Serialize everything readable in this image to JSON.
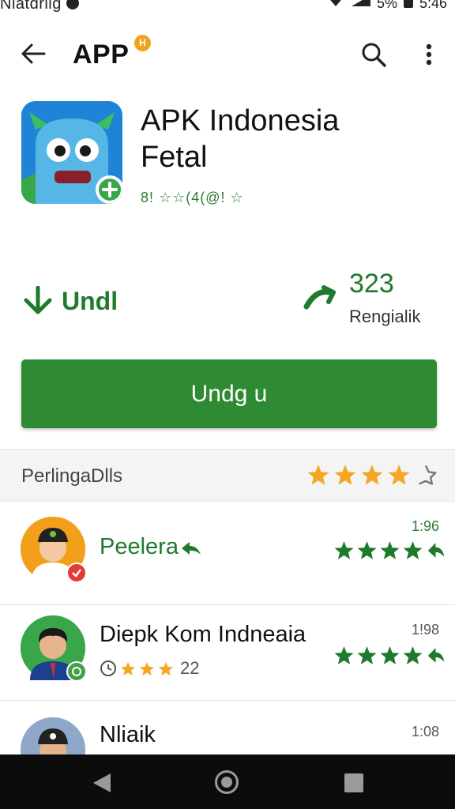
{
  "status_bar": {
    "left_text": "Nlatdrllg",
    "battery_text": "5%",
    "time": "5:46"
  },
  "app_bar": {
    "title": "APP",
    "title_badge": "H"
  },
  "app": {
    "name_line1": "APK Indonesia",
    "name_line2": "Fetal",
    "rating_text": "8! ☆☆(4(@! ☆",
    "icon": "monster-app-icon"
  },
  "stats": {
    "left_label": "Undl",
    "right_value": "323",
    "right_label": "Rengialik"
  },
  "install_button": {
    "label": "Undg u"
  },
  "reviews": {
    "title": "PerlingaDlls",
    "header_stars": 4,
    "items": [
      {
        "name": "Peelera",
        "date": "1:96",
        "stars": 4,
        "badge_color": "#e53935"
      },
      {
        "name": "Diepk Kom Indneaia",
        "date": "1!98",
        "stars": 4,
        "sub_rating_value": "22",
        "sub_rating_stars": 3,
        "badge_color": "#43a047"
      },
      {
        "name": "Nliaik",
        "date": "1:08"
      }
    ]
  },
  "colors": {
    "accent_green": "#2e8b34",
    "star_gold": "#f5a623",
    "star_green": "#1e7a2c"
  }
}
